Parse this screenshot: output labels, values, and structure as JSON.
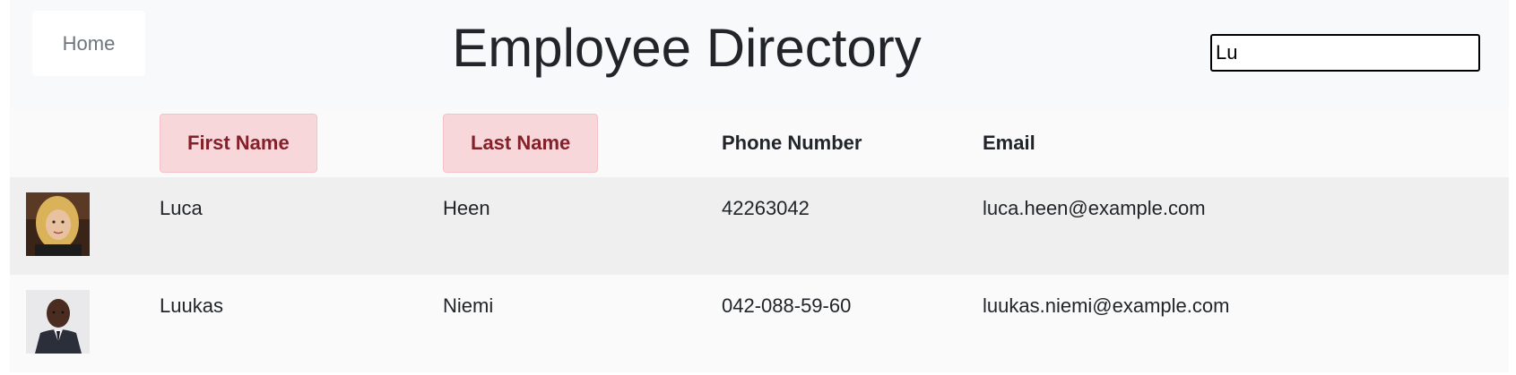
{
  "nav": {
    "home_label": "Home"
  },
  "header": {
    "title": "Employee Directory"
  },
  "search": {
    "value": "Lu"
  },
  "table": {
    "columns": {
      "first_name": "First Name",
      "last_name": "Last Name",
      "phone": "Phone Number",
      "email": "Email"
    },
    "rows": [
      {
        "first": "Luca",
        "last": "Heen",
        "phone": "42263042",
        "email": "luca.heen@example.com"
      },
      {
        "first": "Luukas",
        "last": "Niemi",
        "phone": "042-088-59-60",
        "email": "luukas.niemi@example.com"
      }
    ]
  },
  "colors": {
    "sort_button_bg": "#f8d7da",
    "sort_button_text": "#842029",
    "navbar_bg": "#f8f9fa"
  }
}
